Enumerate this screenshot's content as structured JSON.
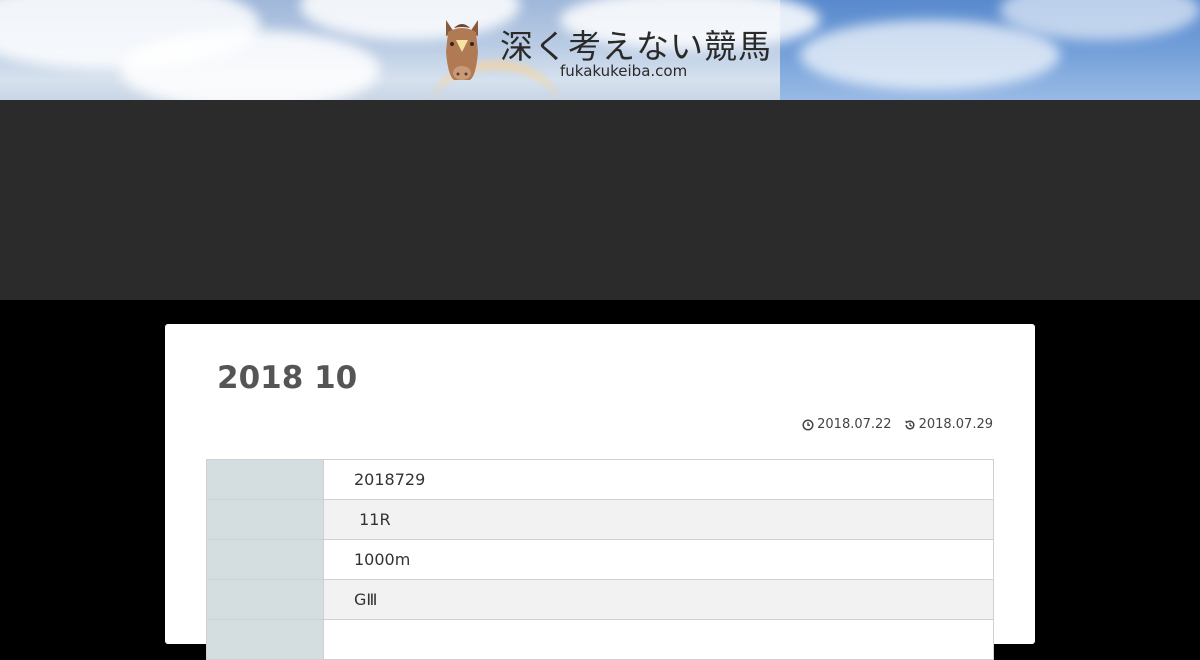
{
  "header": {
    "site_title": "深く考えない競馬",
    "site_domain": "fukakukeiba.com",
    "logo_icon": "horse-head-icon"
  },
  "article": {
    "title": "2018 10",
    "published_icon": "clock-icon",
    "published": "2018.07.22",
    "updated_icon": "history-icon",
    "updated": "2018.07.29",
    "table_rows": [
      {
        "label": "",
        "value": "2018729"
      },
      {
        "label": "",
        "value": " 11R"
      },
      {
        "label": "",
        "value": "1000m"
      },
      {
        "label": "",
        "value": "GⅢ"
      },
      {
        "label": "",
        "value": ""
      }
    ]
  },
  "colors": {
    "ad_band": "#2b2b2b",
    "page_background": "#000000",
    "table_header_cell": "#d4dee0",
    "title_text": "#555555"
  }
}
